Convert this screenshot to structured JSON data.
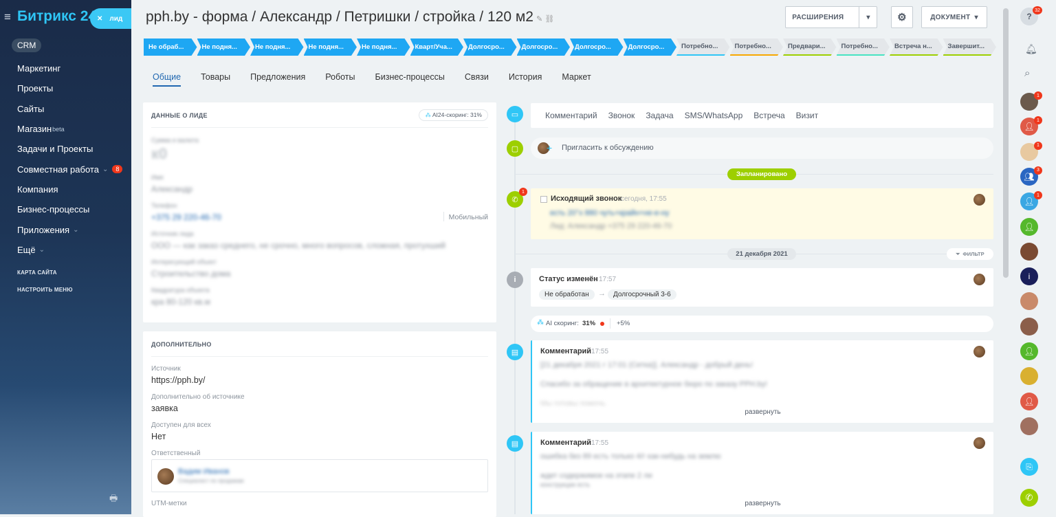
{
  "sidebar": {
    "logo_main": "Битрикс",
    "logo_num": "24",
    "lead_label": "лид",
    "crm": "CRM",
    "items": [
      {
        "label": "Маркетинг"
      },
      {
        "label": "Проекты"
      },
      {
        "label": "Сайты"
      },
      {
        "label": "Магазин",
        "sup": "beta"
      },
      {
        "label": "Задачи и Проекты"
      },
      {
        "label": "Совместная работа",
        "suffix": "⌄",
        "badge": "8"
      },
      {
        "label": "Компания"
      },
      {
        "label": "Бизнес-процессы"
      },
      {
        "label": "Приложения",
        "suffix": "⌄"
      },
      {
        "label": "Ещё",
        "suffix": "⌄"
      }
    ],
    "site_map": "КАРТА САЙТА",
    "configure_menu": "НАСТРОИТЬ МЕНЮ"
  },
  "header": {
    "title": "pph.by - форма / Александр / Петришки / стройка / 120  м2",
    "extensions": "РАСШИРЕНИЯ",
    "document": "ДОКУМЕНТ"
  },
  "stages": [
    {
      "label": "Не обраб...",
      "kind": "blue"
    },
    {
      "label": "Не подня...",
      "kind": "blue"
    },
    {
      "label": "Не подня...",
      "kind": "blue"
    },
    {
      "label": "Не подня...",
      "kind": "blue"
    },
    {
      "label": "Не подня...",
      "kind": "blue"
    },
    {
      "label": "Кварт/Уча...",
      "kind": "blue"
    },
    {
      "label": "Долгосро...",
      "kind": "blue"
    },
    {
      "label": "Долгосро...",
      "kind": "blue"
    },
    {
      "label": "Долгосро...",
      "kind": "blue"
    },
    {
      "label": "Долгосро...",
      "kind": "blue"
    },
    {
      "label": "Потребно...",
      "kind": "grey",
      "line": "#2fc6f6"
    },
    {
      "label": "Потребно...",
      "kind": "grey",
      "line": "#f7a700"
    },
    {
      "label": "Предвари...",
      "kind": "grey",
      "line": "#9dcf00"
    },
    {
      "label": "Потребно...",
      "kind": "grey",
      "line": "#47e4c2"
    },
    {
      "label": "Встреча н...",
      "kind": "grey",
      "line": "#9dcf00"
    },
    {
      "label": "Завершит...",
      "kind": "grey",
      "line": "#9dcf00"
    }
  ],
  "tabs": [
    "Общие",
    "Товары",
    "Предложения",
    "Роботы",
    "Бизнес-процессы",
    "Связи",
    "История",
    "Маркет"
  ],
  "lead_card": {
    "title": "ДАННЫЕ О ЛИДЕ",
    "ai_score": "AI24-скоринг: 31%",
    "phone_type": "Мобильный"
  },
  "extra_card": {
    "title": "ДОПОЛНИТЕЛЬНО",
    "source_label": "Источник",
    "source_value": "https://pph.by/",
    "source_extra_label": "Дополнительно об источнике",
    "source_extra_value": "заявка",
    "available_label": "Доступен для всех",
    "available_value": "Нет",
    "responsible_label": "Ответственный",
    "utm_label": "UTM-метки"
  },
  "timeline": {
    "tabs": [
      "Комментарий",
      "Звонок",
      "Задача",
      "SMS/WhatsApp",
      "Встреча",
      "Визит"
    ],
    "invite": "Пригласить к обсуждению",
    "planned": "Запланировано",
    "call_title": "Исходящий звонок",
    "call_time": "сегодня, 17:55",
    "call_badge": "1",
    "date_sep": "21 декабря 2021",
    "filter": "ФИЛЬТР",
    "status_title": "Статус изменён",
    "status_time": "17:57",
    "status_from": "Не обработан",
    "status_to": "Долгосрочный 3-6",
    "ai_label": "AI скоринг:",
    "ai_value": "31%",
    "ai_delta": "+5%",
    "comment_title": "Комментарий",
    "comment_time": "17:55",
    "expand": "развернуть"
  },
  "right_panel": {
    "help_badge": "32",
    "badges": [
      "1",
      "1",
      "1",
      "3",
      "1"
    ]
  },
  "colors": {
    "accent": "#2fc6f6",
    "stage_active": "#1ea7f3",
    "green": "#9dcf00",
    "red": "#f0371b"
  }
}
